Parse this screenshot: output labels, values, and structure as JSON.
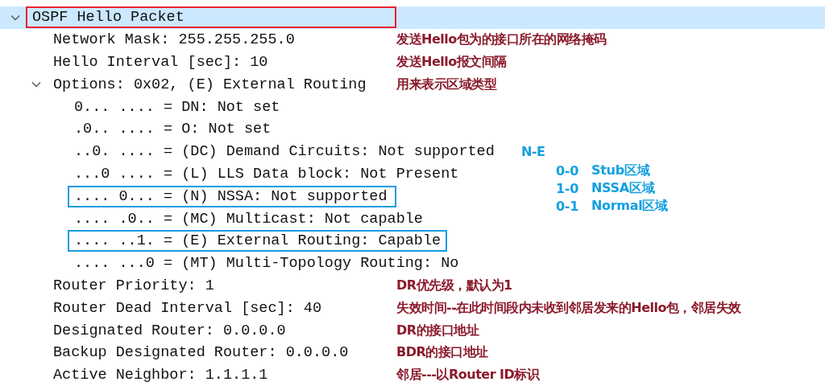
{
  "tree": [
    {
      "label": "OSPF Hello Packet",
      "selected": true,
      "boxed": false,
      "expanded": true,
      "children": [
        {
          "label": "Network Mask: 255.255.255.0",
          "selected": false,
          "boxed": false,
          "note": {
            "kind": "comment",
            "text": "发送Hello包为的接口所在的网络掩码"
          }
        },
        {
          "label": "Hello Interval [sec]: 10",
          "selected": false,
          "boxed": false,
          "note": {
            "kind": "comment",
            "text": "发送Hello报文间隔"
          }
        },
        {
          "label": "Options: 0x02, (E) External Routing",
          "selected": false,
          "boxed": false,
          "expanded": true,
          "note": {
            "kind": "comment",
            "text": "用来表示区域类型"
          },
          "children": [
            {
              "label": "0... .... = DN: Not set",
              "selected": false,
              "boxed": false
            },
            {
              "label": ".0.. .... = O: Not set",
              "selected": false,
              "boxed": false
            },
            {
              "label": "..0. .... = (DC) Demand Circuits: Not supported",
              "selected": false,
              "boxed": false,
              "note": {
                "kind": "legend",
                "text": "N-E"
              }
            },
            {
              "label": "...0 .... = (L) LLS Data block: Not Present",
              "selected": false,
              "boxed": false
            },
            {
              "label": ".... 0... = (N) NSSA: Not supported",
              "selected": false,
              "boxed": true
            },
            {
              "label": ".... .0.. = (MC) Multicast: Not capable",
              "selected": false,
              "boxed": false
            },
            {
              "label": ".... ..1. = (E) External Routing: Capable",
              "selected": false,
              "boxed": true
            },
            {
              "label": ".... ...0 = (MT) Multi-Topology Routing: No",
              "selected": false,
              "boxed": false
            }
          ]
        },
        {
          "label": "Router Priority: 1",
          "selected": false,
          "boxed": false,
          "note": {
            "kind": "comment",
            "text": "DR优先级，默认为1"
          }
        },
        {
          "label": "Router Dead Interval [sec]: 40",
          "selected": false,
          "boxed": false,
          "note": {
            "kind": "comment",
            "text": "失效时间--在此时间段内未收到邻居发来的Hello包，邻居失效"
          }
        },
        {
          "label": "Designated Router: 0.0.0.0",
          "selected": false,
          "boxed": false,
          "note": {
            "kind": "comment",
            "text": "DR的接口地址"
          }
        },
        {
          "label": "Backup Designated Router: 0.0.0.0",
          "selected": false,
          "boxed": false,
          "note": {
            "kind": "comment",
            "text": "BDR的接口地址"
          }
        },
        {
          "label": "Active Neighbor: 1.1.1.1",
          "selected": false,
          "boxed": false,
          "note": {
            "kind": "comment",
            "text": "邻居---以Router ID标识"
          }
        }
      ]
    }
  ],
  "legend": [
    {
      "code": "0-0",
      "text": "Stub区域"
    },
    {
      "code": "1-0",
      "text": "NSSA区域"
    },
    {
      "code": "0-1",
      "text": "Normal区域"
    }
  ]
}
